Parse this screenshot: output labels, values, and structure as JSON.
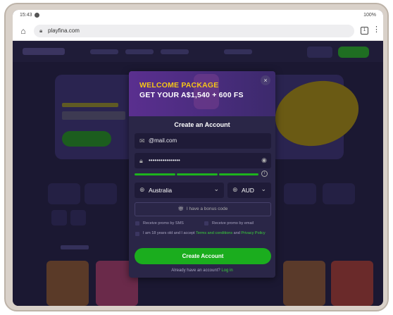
{
  "statusbar": {
    "time": "15:43",
    "battery": "100%"
  },
  "browser": {
    "url": "playfina.com",
    "tabs_count": "1",
    "menu": "⋮"
  },
  "modal": {
    "header_line1": "WELCOME PACKAGE",
    "header_line2": "GET YOUR A$1,540 + 600 FS",
    "close": "×",
    "title": "Create an Account",
    "email": {
      "value": "@mail.com",
      "icon": "mail-icon"
    },
    "password": {
      "value": "••••••••••••••••",
      "icon": "lock-icon"
    },
    "country": {
      "value": "Australia",
      "icon": "globe-icon"
    },
    "currency": {
      "value": "AUD",
      "icon": "globe-icon"
    },
    "bonus_label": "I have a bonus code",
    "promo_sms": "Receive promo by SMS",
    "promo_email": "Receive promo by email",
    "terms_prefix": "I am 18 years old and I accept",
    "terms_link": "Terms and conditions",
    "terms_and": "and",
    "privacy_link": "Privacy Policy",
    "cta": "Create Account",
    "already_text": "Already have an account?",
    "login_link": "Log in"
  },
  "colors": {
    "accent_green": "#1bad1e",
    "header_yellow": "#f5c518",
    "modal_bg": "#2a2647"
  }
}
